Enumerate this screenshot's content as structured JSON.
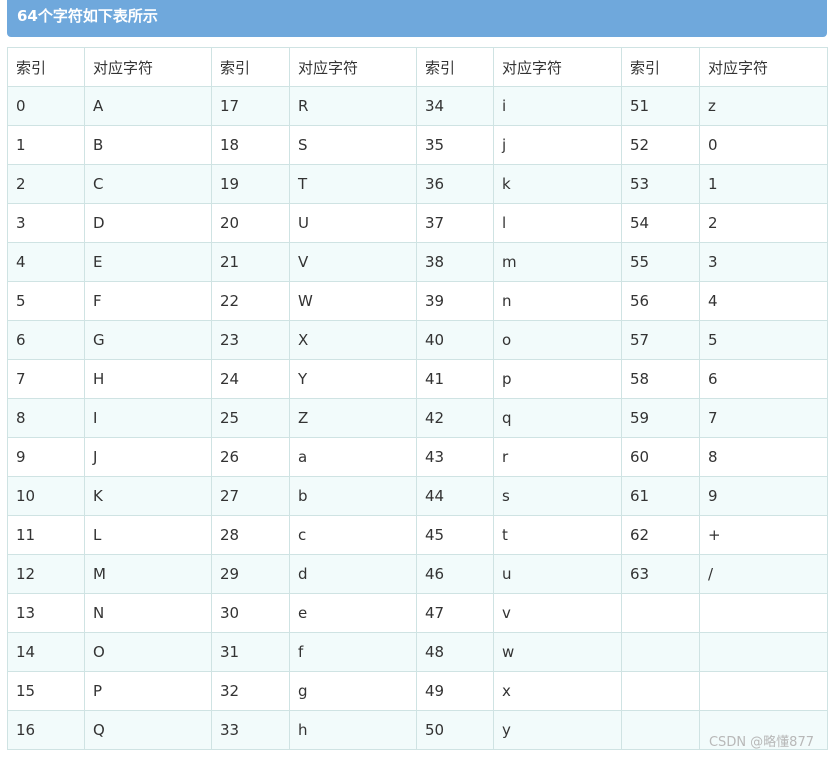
{
  "header": {
    "title": "64个字符如下表所示"
  },
  "table": {
    "columns": [
      "索引",
      "对应字符",
      "索引",
      "对应字符",
      "索引",
      "对应字符",
      "索引",
      "对应字符"
    ],
    "rows": [
      [
        "0",
        "A",
        "17",
        "R",
        "34",
        "i",
        "51",
        "z"
      ],
      [
        "1",
        "B",
        "18",
        "S",
        "35",
        "j",
        "52",
        "0"
      ],
      [
        "2",
        "C",
        "19",
        "T",
        "36",
        "k",
        "53",
        "1"
      ],
      [
        "3",
        "D",
        "20",
        "U",
        "37",
        "l",
        "54",
        "2"
      ],
      [
        "4",
        "E",
        "21",
        "V",
        "38",
        "m",
        "55",
        "3"
      ],
      [
        "5",
        "F",
        "22",
        "W",
        "39",
        "n",
        "56",
        "4"
      ],
      [
        "6",
        "G",
        "23",
        "X",
        "40",
        "o",
        "57",
        "5"
      ],
      [
        "7",
        "H",
        "24",
        "Y",
        "41",
        "p",
        "58",
        "6"
      ],
      [
        "8",
        "I",
        "25",
        "Z",
        "42",
        "q",
        "59",
        "7"
      ],
      [
        "9",
        "J",
        "26",
        "a",
        "43",
        "r",
        "60",
        "8"
      ],
      [
        "10",
        "K",
        "27",
        "b",
        "44",
        "s",
        "61",
        "9"
      ],
      [
        "11",
        "L",
        "28",
        "c",
        "45",
        "t",
        "62",
        "+"
      ],
      [
        "12",
        "M",
        "29",
        "d",
        "46",
        "u",
        "63",
        "/"
      ],
      [
        "13",
        "N",
        "30",
        "e",
        "47",
        "v",
        "",
        ""
      ],
      [
        "14",
        "O",
        "31",
        "f",
        "48",
        "w",
        "",
        ""
      ],
      [
        "15",
        "P",
        "32",
        "g",
        "49",
        "x",
        "",
        ""
      ],
      [
        "16",
        "Q",
        "33",
        "h",
        "50",
        "y",
        "",
        ""
      ]
    ]
  },
  "watermark": {
    "text": "CSDN @略懂877"
  },
  "colors": {
    "header_bg": "#6fa8dc",
    "row_stripe": "#f2fbfb",
    "border": "#cfe3e3"
  }
}
